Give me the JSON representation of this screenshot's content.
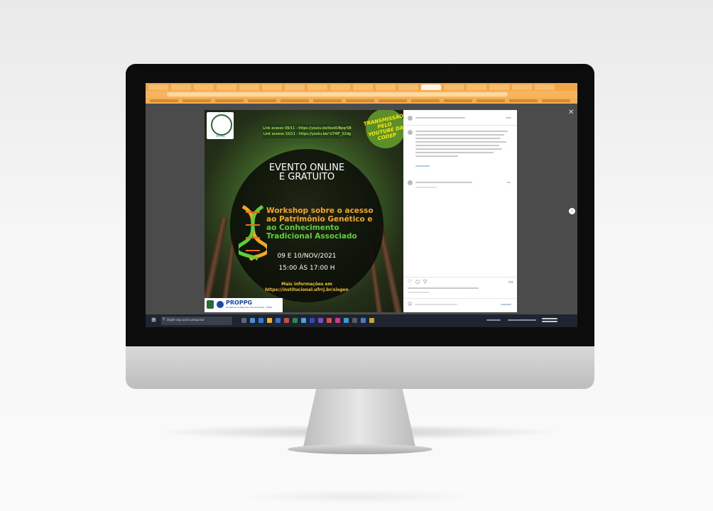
{
  "poster": {
    "seal_text": "UFRRJ",
    "link1": "Link acesso 09/11 - https://youtu.be/ibedUBpqrS8",
    "link2": "Link acesso 10/11 - https://youtu.be/-U74IF_S2dg",
    "badge": "TRANSMISSÃO PELO YOUTUBE DA CODEP",
    "heading_line1": "EVENTO ONLINE",
    "heading_line2": "E GRATUITO",
    "workshop_line1": "Workshop sobre o acesso",
    "workshop_line2": "ao Patrimônio Genético e",
    "workshop_line3": "ao Conhecimento",
    "workshop_line4": "Tradicional Associado",
    "date": "09 E 10/NOV/2021",
    "time": "15:00 ÀS 17:00 H",
    "info_line1": "Mais informações em",
    "info_line2": "https://institucional.ufrrj.br/sisgen",
    "footer_title": "PROPPG",
    "footer_subtitle": "Pró-Reitoria de Pesquisa e Pós-Graduação - UFRRJ"
  },
  "taskbar": {
    "search_placeholder": "Digite aqui para pesquisar"
  },
  "colors": {
    "browser_chrome": "#f2a64a",
    "workshop_orange": "#f6a623",
    "workshop_green": "#5fcf36",
    "badge_green": "#5b8f2a",
    "badge_text": "#ffe800"
  },
  "icons": [
    "close-icon",
    "next-arrow-icon",
    "windows-start-icon",
    "search-icon",
    "dna-icon",
    "heart-icon",
    "comment-icon",
    "share-icon",
    "bookmark-icon"
  ]
}
